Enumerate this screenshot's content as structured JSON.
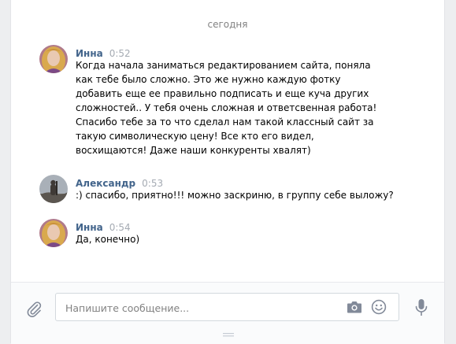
{
  "date_divider": "сегодня",
  "messages": [
    {
      "author": "Инна",
      "time": "0:52",
      "avatar": "avatar-inna",
      "text": "Когда начала заниматься редактированием сайта, поняла как тебе было сложно. Это же нужно каждую фотку добавить еще ее правильно подписать и еще куча других сложностей.. У тебя очень сложная и ответсвенная работа! Спасибо тебе за то что сделал нам такой классный сайт за такую символическую цену! Все кто его видел, восхищаются! Даже наши конкуренты хвалят)"
    },
    {
      "author": "Александр",
      "time": "0:53",
      "avatar": "avatar-alexandr",
      "text": ":) спасибо, приятно!!! можно заскриню, в группу себе выложу?"
    },
    {
      "author": "Инна",
      "time": "0:54",
      "avatar": "avatar-inna",
      "text": "Да, конечно)"
    }
  ],
  "composer": {
    "placeholder": "Напишите сообщение...",
    "value": ""
  },
  "icons": {
    "attach": "paperclip-icon",
    "camera": "camera-icon",
    "emoji": "smile-icon",
    "voice": "microphone-icon",
    "resize": "resize-grip-icon"
  },
  "colors": {
    "author": "#42648b",
    "time": "#a5abb3",
    "icon": "#828a99",
    "background": "#edeef0"
  }
}
